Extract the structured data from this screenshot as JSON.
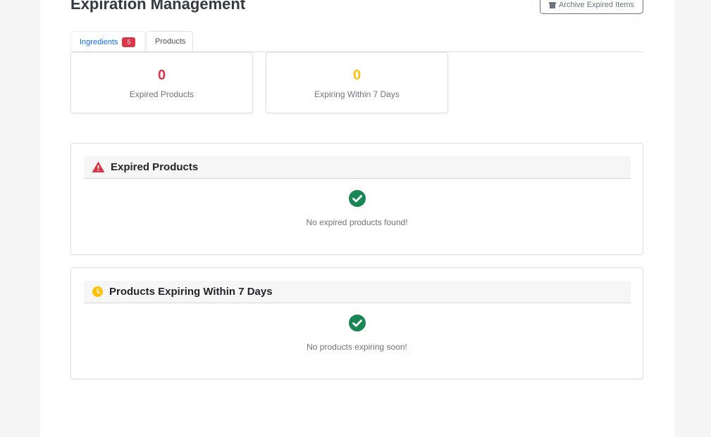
{
  "header": {
    "title": "Expiration Management",
    "archive_button": "Archive Expired Items",
    "archive_icon": "archive-icon"
  },
  "tabs": [
    {
      "label": "Ingredients",
      "badge": "5",
      "active": false
    },
    {
      "label": "Products",
      "active": true
    }
  ],
  "stats": [
    {
      "value": "0",
      "label": "Expired Products",
      "color": "#dc3545"
    },
    {
      "value": "0",
      "label": "Expiring Within 7 Days",
      "color": "#ffc107"
    }
  ],
  "sections": [
    {
      "title": "Expired Products",
      "icon": "warning-triangle-icon",
      "icon_color": "#dc3545",
      "empty_icon": "check-circle-icon",
      "empty_text": "No expired products found!"
    },
    {
      "title": "Products Expiring Within 7 Days",
      "icon": "clock-icon",
      "icon_color": "#ffc107",
      "empty_icon": "check-circle-icon",
      "empty_text": "No products expiring soon!"
    }
  ],
  "colors": {
    "success": "#198754",
    "primary": "#0d6efd"
  }
}
